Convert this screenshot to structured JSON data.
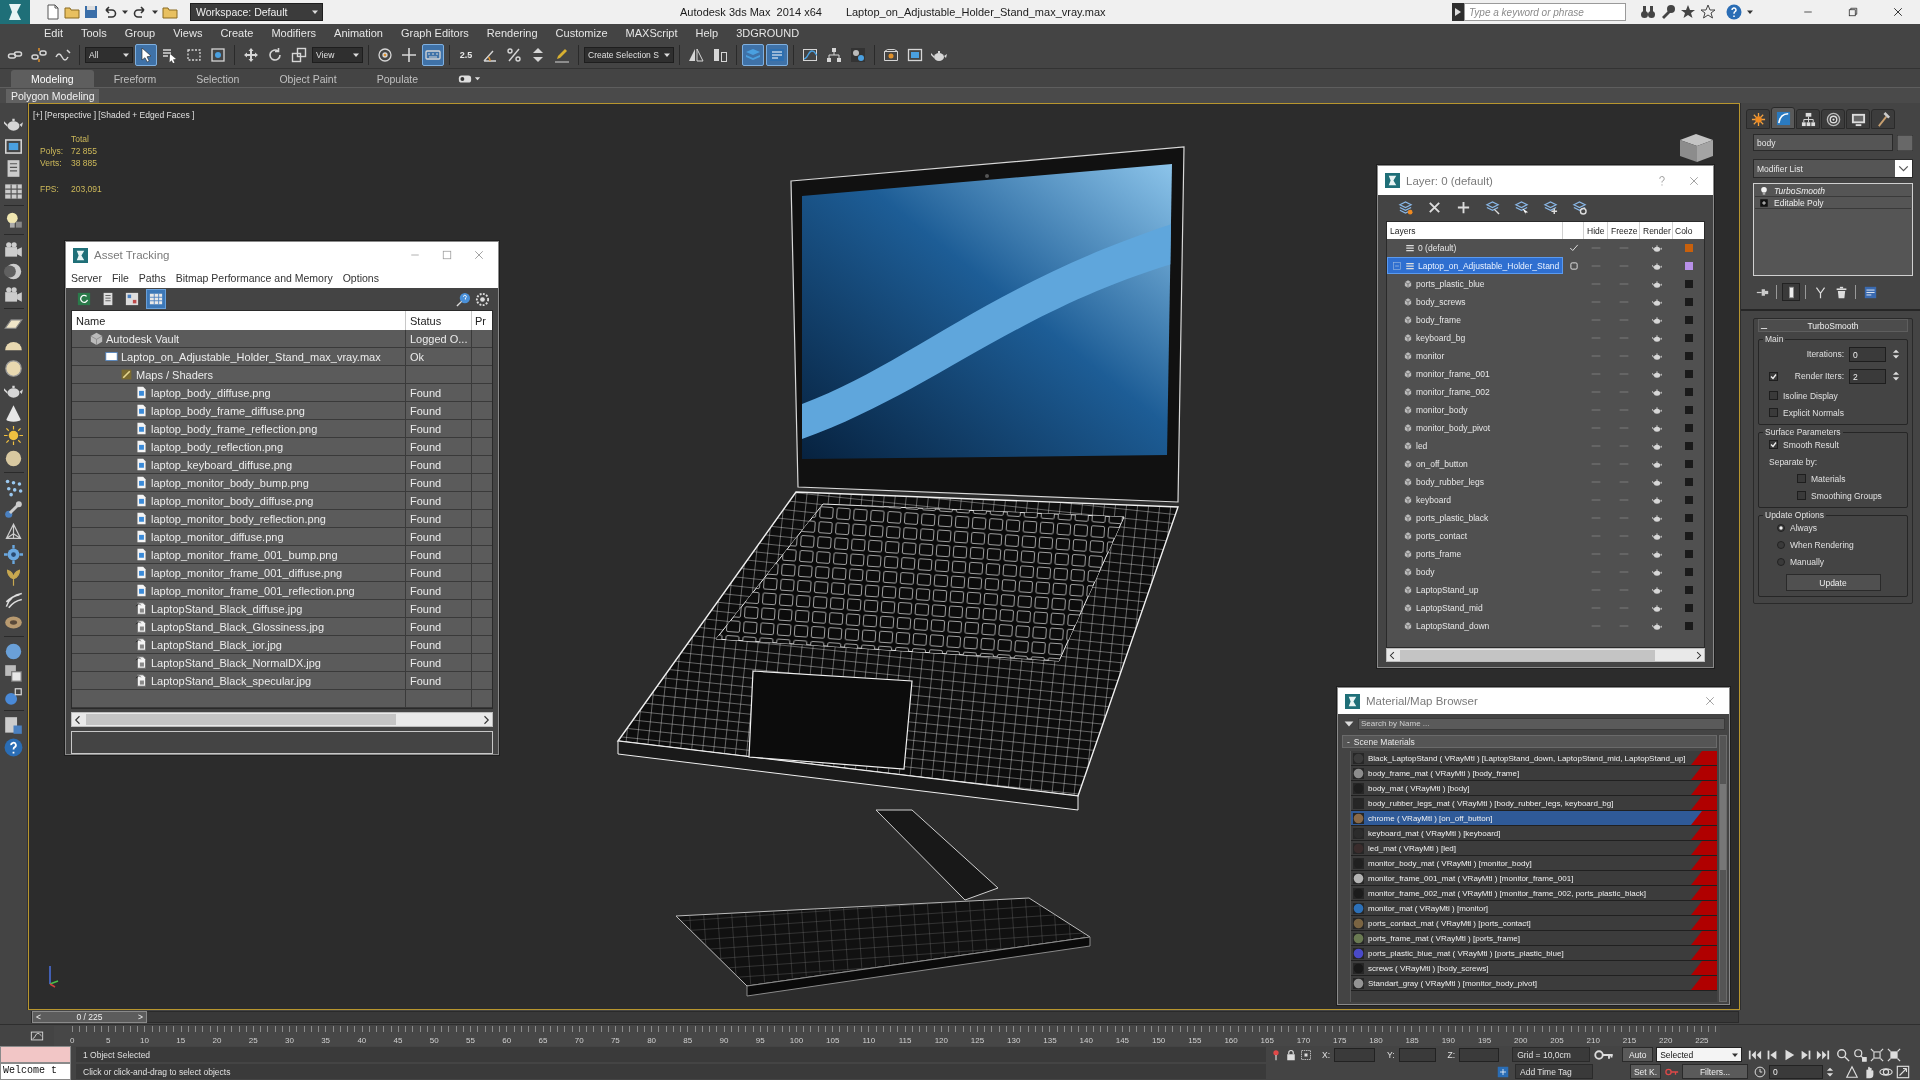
{
  "title_bar": {
    "workspace": "Workspace: Default",
    "app_title": "Autodesk 3ds Max  2014 x64",
    "file_name": "Laptop_on_Adjustable_Holder_Stand_max_vray.max",
    "search": {
      "placeholder": "Type a keyword or phrase"
    }
  },
  "menu": [
    "Edit",
    "Tools",
    "Group",
    "Views",
    "Create",
    "Modifiers",
    "Animation",
    "Graph Editors",
    "Rendering",
    "Customize",
    "MAXScript",
    "Help",
    "3DGROUND"
  ],
  "toolbar": [
    {
      "kind": "button",
      "selected": false
    },
    {
      "kind": "button",
      "selected": false
    },
    {
      "kind": "button",
      "selected": false
    },
    {
      "kind": "dropdown",
      "value": "All"
    },
    {
      "kind": "button",
      "selected": true
    },
    {
      "kind": "button",
      "selected": false
    },
    {
      "kind": "button",
      "selected": false
    },
    {
      "kind": "button",
      "selected": false
    },
    {
      "kind": "button",
      "selected": false
    },
    {
      "kind": "button",
      "selected": false
    },
    {
      "kind": "button",
      "selected": false
    },
    {
      "kind": "dropdown",
      "value": "View"
    },
    {
      "kind": "button",
      "selected": false
    },
    {
      "kind": "button",
      "selected": false
    },
    {
      "kind": "button",
      "selected": true
    },
    {
      "kind": "snap",
      "label": "2.5",
      "selected": false
    },
    {
      "kind": "button",
      "selected": false
    },
    {
      "kind": "button",
      "selected": false
    },
    {
      "kind": "button",
      "selected": false
    },
    {
      "kind": "button",
      "selected": false
    },
    {
      "kind": "dropdown",
      "value": "Create Selection S"
    },
    {
      "kind": "button",
      "selected": false
    },
    {
      "kind": "button",
      "selected": false
    },
    {
      "kind": "button",
      "selected": true
    },
    {
      "kind": "button",
      "selected": true
    },
    {
      "kind": "button",
      "selected": false
    },
    {
      "kind": "button",
      "selected": false
    },
    {
      "kind": "button",
      "selected": false
    },
    {
      "kind": "button",
      "selected": false
    },
    {
      "kind": "button",
      "selected": false
    },
    {
      "kind": "button",
      "selected": false
    }
  ],
  "ribbon": {
    "tabs": [
      {
        "label": "Modeling",
        "selected": true
      },
      {
        "label": "Freeform",
        "selected": false
      },
      {
        "label": "Selection",
        "selected": false
      },
      {
        "label": "Object Paint",
        "selected": false
      },
      {
        "label": "Populate",
        "selected": false
      }
    ],
    "panels": [
      "Polygon Modeling"
    ]
  },
  "viewport": {
    "menus": [
      "[+]",
      "[Perspective ]",
      "[Shaded + Edged Faces ]"
    ],
    "stats": {
      "heading": "Total",
      "counts": [
        {
          "label": "Polys:",
          "value": "72 855"
        },
        {
          "label": "Verts:",
          "value": "38 885"
        }
      ],
      "fps": {
        "label": "FPS:",
        "value": "203,091"
      }
    }
  },
  "asset_tracking": {
    "title": "Asset Tracking",
    "menu": [
      "Server",
      "File",
      "Paths",
      "Bitmap Performance and Memory",
      "Options"
    ],
    "view_buttons": [
      {
        "selected": false
      },
      {
        "selected": false
      },
      {
        "selected": false
      },
      {
        "selected": true
      }
    ],
    "columns": [
      "Name",
      "Status",
      "Pr"
    ],
    "tree": [
      {
        "kind": "vault",
        "name": "Autodesk Vault",
        "status": "Logged O...",
        "children": [
          {
            "kind": "scene",
            "name": "Laptop_on_Adjustable_Holder_Stand_max_vray.max",
            "status": "Ok",
            "children": [
              {
                "kind": "folder",
                "name": "Maps / Shaders",
                "children": [
                  {
                    "kind": "png",
                    "name": "laptop_body_diffuse.png",
                    "status": "Found"
                  },
                  {
                    "kind": "png",
                    "name": "laptop_body_frame_diffuse.png",
                    "status": "Found"
                  },
                  {
                    "kind": "png",
                    "name": "laptop_body_frame_reflection.png",
                    "status": "Found"
                  },
                  {
                    "kind": "png",
                    "name": "laptop_body_reflection.png",
                    "status": "Found"
                  },
                  {
                    "kind": "png",
                    "name": "laptop_keyboard_diffuse.png",
                    "status": "Found"
                  },
                  {
                    "kind": "png",
                    "name": "laptop_monitor_body_bump.png",
                    "status": "Found"
                  },
                  {
                    "kind": "png",
                    "name": "laptop_monitor_body_diffuse.png",
                    "status": "Found"
                  },
                  {
                    "kind": "png",
                    "name": "laptop_monitor_body_reflection.png",
                    "status": "Found"
                  },
                  {
                    "kind": "png",
                    "name": "laptop_monitor_diffuse.png",
                    "status": "Found"
                  },
                  {
                    "kind": "png",
                    "name": "laptop_monitor_frame_001_bump.png",
                    "status": "Found"
                  },
                  {
                    "kind": "png",
                    "name": "laptop_monitor_frame_001_diffuse.png",
                    "status": "Found"
                  },
                  {
                    "kind": "png",
                    "name": "laptop_monitor_frame_001_reflection.png",
                    "status": "Found"
                  },
                  {
                    "kind": "jpg",
                    "name": "LaptopStand_Black_diffuse.jpg",
                    "status": "Found"
                  },
                  {
                    "kind": "jpg",
                    "name": "LaptopStand_Black_Glossiness.jpg",
                    "status": "Found"
                  },
                  {
                    "kind": "jpg",
                    "name": "LaptopStand_Black_ior.jpg",
                    "status": "Found"
                  },
                  {
                    "kind": "jpg",
                    "name": "LaptopStand_Black_NormalDX.jpg",
                    "status": "Found"
                  },
                  {
                    "kind": "jpg",
                    "name": "LaptopStand_Black_specular.jpg",
                    "status": "Found"
                  }
                ]
              }
            ]
          }
        ]
      }
    ]
  },
  "layer_manager": {
    "title": "Layer: 0 (default)",
    "columns": [
      "Layers",
      "Hide",
      "Freeze",
      "Render",
      "Colo"
    ],
    "layers": [
      {
        "name": "0 (default)",
        "current": true,
        "selected": false,
        "hidden": false,
        "frozen": false,
        "color": "#c8600c"
      },
      {
        "name": "Laptop_on_Adjustable_Holder_Stand",
        "current": false,
        "selected": true,
        "expanded": true,
        "hidden": false,
        "frozen": false,
        "color": "#b890e8",
        "children": [
          {
            "name": "ports_plastic_blue",
            "hidden": false,
            "frozen": false
          },
          {
            "name": "body_screws",
            "hidden": false,
            "frozen": false
          },
          {
            "name": "body_frame",
            "hidden": false,
            "frozen": false
          },
          {
            "name": "keyboard_bg",
            "hidden": false,
            "frozen": false
          },
          {
            "name": "monitor",
            "hidden": false,
            "frozen": false
          },
          {
            "name": "monitor_frame_001",
            "hidden": false,
            "frozen": false
          },
          {
            "name": "monitor_frame_002",
            "hidden": false,
            "frozen": false
          },
          {
            "name": "monitor_body",
            "hidden": false,
            "frozen": false
          },
          {
            "name": "monitor_body_pivot",
            "hidden": false,
            "frozen": false
          },
          {
            "name": "led",
            "hidden": false,
            "frozen": false
          },
          {
            "name": "on_off_button",
            "hidden": false,
            "frozen": false
          },
          {
            "name": "body_rubber_legs",
            "hidden": false,
            "frozen": false
          },
          {
            "name": "keyboard",
            "hidden": false,
            "frozen": false
          },
          {
            "name": "ports_plastic_black",
            "hidden": false,
            "frozen": false
          },
          {
            "name": "ports_contact",
            "hidden": false,
            "frozen": false
          },
          {
            "name": "ports_frame",
            "hidden": false,
            "frozen": false
          },
          {
            "name": "body",
            "hidden": false,
            "frozen": false
          },
          {
            "name": "LaptopStand_up",
            "hidden": false,
            "frozen": false
          },
          {
            "name": "LaptopStand_mid",
            "hidden": false,
            "frozen": false
          },
          {
            "name": "LaptopStand_down",
            "hidden": false,
            "frozen": false
          }
        ]
      }
    ]
  },
  "material_browser": {
    "title": "Material/Map Browser",
    "search": {
      "placeholder": "Search by Name ..."
    },
    "group": {
      "expander": "-",
      "label": "Scene Materials"
    },
    "materials": [
      {
        "label": "Black_LaptopStand ( VRayMtl ) [LaptopStand_down, LaptopStand_mid, LaptopStand_up]",
        "color": "#3c3c3c",
        "selected": false
      },
      {
        "label": "body_frame_mat ( VRayMtl ) [body_frame]",
        "color": "#8c8c8c",
        "selected": false
      },
      {
        "label": "body_mat ( VRayMtl ) [body]",
        "color": "#1e1e1e",
        "selected": false
      },
      {
        "label": "body_rubber_legs_mat ( VRayMtl ) [body_rubber_legs, keyboard_bg]",
        "color": "#262626",
        "selected": false
      },
      {
        "label": "chrome ( VRayMtl ) [on_off_button]",
        "color": "#8a6a48",
        "selected": true
      },
      {
        "label": "keyboard_mat ( VRayMtl ) [keyboard]",
        "color": "#2c2c2c",
        "selected": false
      },
      {
        "label": "led_mat ( VRayMtl ) [led]",
        "color": "#3a2c2c",
        "selected": false
      },
      {
        "label": "monitor_body_mat ( VRayMtl ) [monitor_body]",
        "color": "#202020",
        "selected": false
      },
      {
        "label": "monitor_frame_001_mat ( VRayMtl ) [monitor_frame_001]",
        "color": "#b4b4b4",
        "selected": false
      },
      {
        "label": "monitor_frame_002_mat ( VRayMtl ) [monitor_frame_002, ports_plastic_black]",
        "color": "#1c1c1c",
        "selected": false
      },
      {
        "label": "monitor_mat ( VRayMtl ) [monitor]",
        "color": "#2c70b8",
        "selected": false
      },
      {
        "label": "ports_contact_mat ( VRayMtl ) [ports_contact]",
        "color": "#7a6442",
        "selected": false
      },
      {
        "label": "ports_frame_mat ( VRayMtl ) [ports_frame]",
        "color": "#6a7a52",
        "selected": false
      },
      {
        "label": "ports_plastic_blue_mat ( VRayMtl ) [ports_plastic_blue]",
        "color": "#4a4ac8",
        "selected": false
      },
      {
        "label": "screws ( VRayMtl ) [body_screws]",
        "color": "#181818",
        "selected": false
      },
      {
        "label": "Standart_gray ( VRayMtl ) [monitor_body_pivot]",
        "color": "#949494",
        "selected": false
      }
    ]
  },
  "command_panel": {
    "tabs": [
      {
        "selected": false
      },
      {
        "selected": true
      },
      {
        "selected": false
      },
      {
        "selected": false
      },
      {
        "selected": false
      },
      {
        "selected": false
      }
    ],
    "object_name": "body",
    "modifier_list": "Modifier List",
    "stack": [
      {
        "kind": "modifier",
        "label": "TurboSmooth",
        "on": true
      },
      {
        "kind": "base",
        "label": "Editable Poly",
        "expanded": false
      }
    ],
    "tool_buttons": [
      {
        "selected": false
      },
      {
        "selected": true
      },
      {
        "selected": false
      },
      {
        "selected": false
      },
      {
        "selected": false
      }
    ],
    "rollout": {
      "title": "TurboSmooth",
      "expanded": true,
      "groups": [
        {
          "title": "Main",
          "controls": [
            {
              "kind": "spinner",
              "label": "Iterations:",
              "value": "0"
            },
            {
              "kind": "spinner",
              "label": "Render Iters:",
              "value": "2",
              "checked": true
            },
            {
              "kind": "checkbox",
              "label": "Isoline Display",
              "checked": false
            },
            {
              "kind": "checkbox",
              "label": "Explicit Normals",
              "checked": false
            }
          ]
        },
        {
          "title": "Surface Parameters",
          "controls": [
            {
              "kind": "checkbox",
              "label": "Smooth Result",
              "checked": true
            },
            {
              "kind": "label",
              "label": "Separate by:",
              "children": [
                {
                  "kind": "checkbox",
                  "label": "Materials",
                  "checked": false
                },
                {
                  "kind": "checkbox",
                  "label": "Smoothing Groups",
                  "checked": false
                }
              ]
            }
          ]
        },
        {
          "title": "Update Options",
          "controls": [
            {
              "kind": "radio",
              "label": "Always",
              "selected": true
            },
            {
              "kind": "radio",
              "label": "When Rendering",
              "selected": false
            },
            {
              "kind": "radio",
              "label": "Manually",
              "selected": false
            },
            {
              "kind": "button",
              "label": "Update"
            }
          ]
        }
      ]
    }
  },
  "time_slider": {
    "prev": "<",
    "label": "0 / 225",
    "next": ">",
    "level": 0
  },
  "track_bar": {
    "ticks": [
      "0",
      "5",
      "10",
      "15",
      "20",
      "25",
      "30",
      "35",
      "40",
      "45",
      "50",
      "55",
      "60",
      "65",
      "70",
      "75",
      "80",
      "85",
      "90",
      "95",
      "100",
      "105",
      "110",
      "115",
      "120",
      "125",
      "130",
      "135",
      "140",
      "145",
      "150",
      "155",
      "160",
      "165",
      "170",
      "175",
      "180",
      "185",
      "190",
      "195",
      "200",
      "205",
      "210",
      "215",
      "220",
      "225"
    ]
  },
  "status_bar": {
    "listener_output": "Welcome t",
    "selection": "1 Object Selected",
    "prompt": "Click or click-and-drag to select objects",
    "coordinates": [
      "X:",
      "Y:",
      "Z:"
    ],
    "grid": "Grid = 10,0cm",
    "time_tag": "Add Time Tag",
    "auto_key": {
      "label": "Auto",
      "on": false
    },
    "key_mode": "Selected",
    "set_key": "Set K.",
    "filters": "Filters...",
    "frame": "0"
  }
}
